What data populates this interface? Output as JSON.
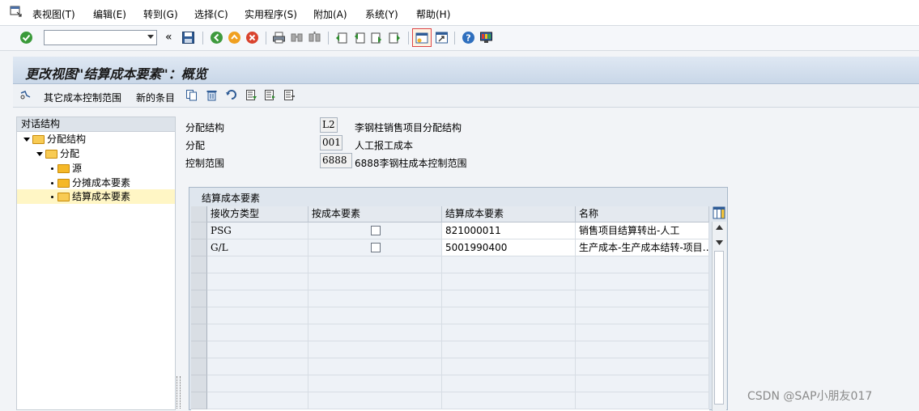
{
  "menubar": {
    "items": [
      "表视图(T)",
      "编辑(E)",
      "转到(G)",
      "选择(C)",
      "实用程序(S)",
      "附加(A)",
      "系统(Y)",
      "帮助(H)"
    ]
  },
  "toolbar": {
    "command_value": "",
    "double_arrow": "«"
  },
  "screen": {
    "title": "更改视图\"结算成本要素\"：概览"
  },
  "app_toolbar": {
    "other_scope_label": "其它成本控制范围",
    "new_entries_label": "新的条目"
  },
  "dialog_structure": {
    "header": "对话结构",
    "nodes": [
      {
        "label": "分配结构"
      },
      {
        "label": "分配"
      },
      {
        "label": "源"
      },
      {
        "label": "分摊成本要素"
      },
      {
        "label": "结算成本要素"
      }
    ]
  },
  "header_fields": [
    {
      "label": "分配结构",
      "value": "L2",
      "desc": "李钢柱销售项目分配结构"
    },
    {
      "label": "分配",
      "value": "001",
      "desc": "人工报工成本"
    },
    {
      "label": "控制范围",
      "value": "6888",
      "desc": "6888李钢柱成本控制范围"
    }
  ],
  "table": {
    "title": "结算成本要素",
    "columns": [
      "接收方类型",
      "按成本要素",
      "结算成本要素",
      "名称"
    ],
    "rows": [
      {
        "receiver": "PSG",
        "checked": false,
        "element": "821000011",
        "name": "销售项目结算转出-人工"
      },
      {
        "receiver": "G/L",
        "checked": false,
        "element": "5001990400",
        "name": "生产成本-生产成本结转-项目…"
      }
    ]
  },
  "watermark": "CSDN @SAP小朋友017",
  "colors": {
    "accent": "#1a5aa6",
    "selection": "#fff6c5"
  }
}
